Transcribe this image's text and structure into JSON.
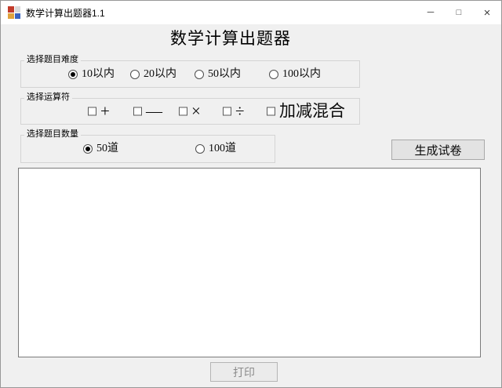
{
  "window": {
    "title": "数学计算出题器1.1",
    "controls": {
      "minimize": "─",
      "maximize": "□",
      "close": "×"
    }
  },
  "heading": "数学计算出题器",
  "groups": {
    "difficulty": {
      "label": "选择题目难度",
      "type": "radio",
      "options": [
        {
          "label": "10以内",
          "selected": true
        },
        {
          "label": "20以内",
          "selected": false
        },
        {
          "label": "50以内",
          "selected": false
        },
        {
          "label": "100以内",
          "selected": false
        }
      ]
    },
    "operators": {
      "label": "选择运算符",
      "type": "checkbox",
      "options": [
        {
          "label": "+",
          "checked": false
        },
        {
          "label": "—",
          "checked": false
        },
        {
          "label": "×",
          "checked": false
        },
        {
          "label": "÷",
          "checked": false
        },
        {
          "label": "加减混合",
          "checked": false
        }
      ]
    },
    "quantity": {
      "label": "选择题目数量",
      "type": "radio",
      "options": [
        {
          "label": "50道",
          "selected": true
        },
        {
          "label": "100道",
          "selected": false
        }
      ]
    }
  },
  "buttons": {
    "generate": "生成试卷",
    "print": "打印",
    "print_enabled": false
  },
  "output_area": {
    "value": ""
  },
  "colors": {
    "titlebar_bg": "#ffffff",
    "client_bg": "#f0f0f0",
    "button_bg": "#e3e3e3",
    "button_border": "#a9a9a9",
    "groupbox_border": "#d4d4d4",
    "textarea_border": "#7a7a7a",
    "disabled_text": "#8b8b8b",
    "radio_dot": "#000000"
  }
}
